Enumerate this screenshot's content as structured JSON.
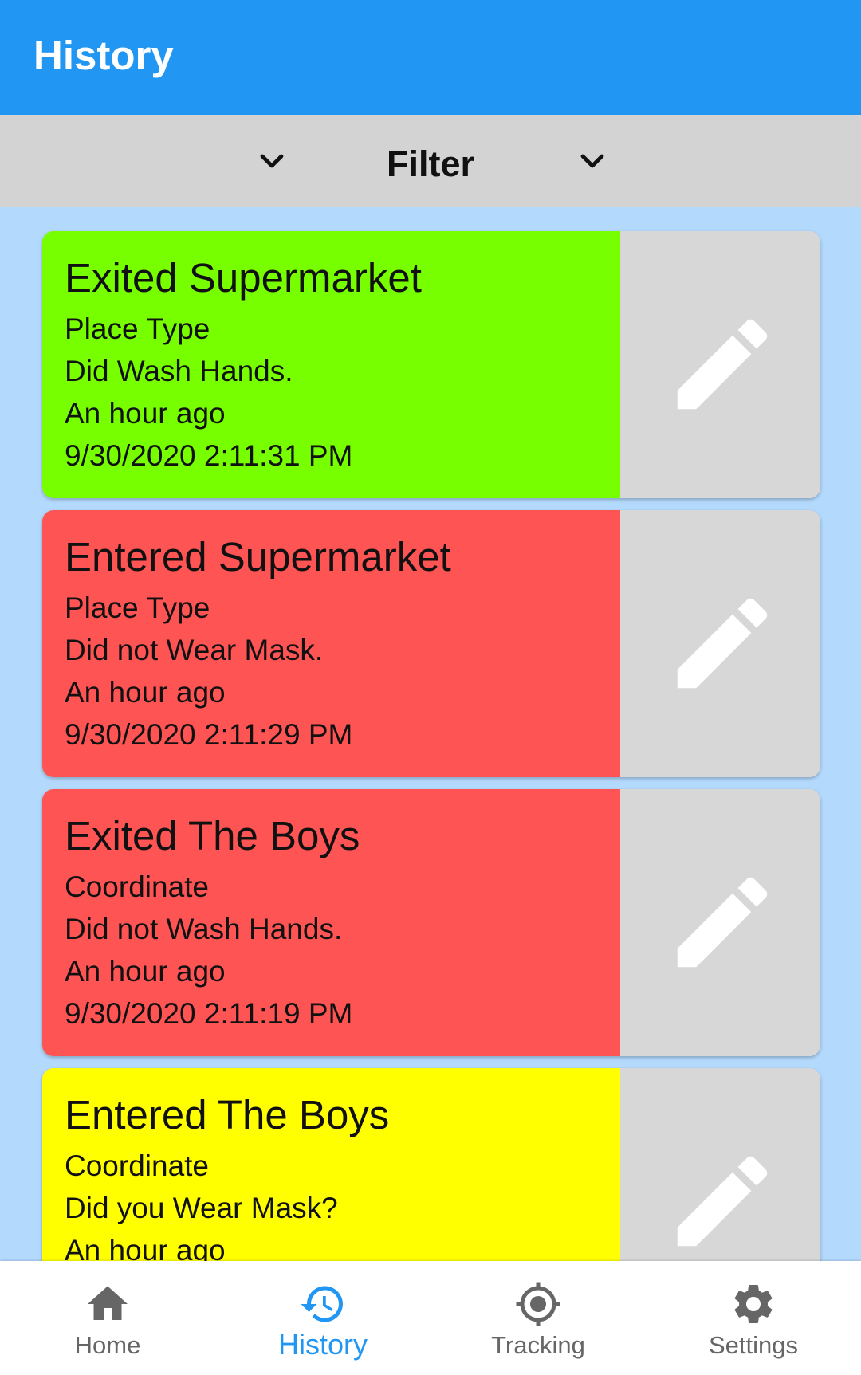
{
  "appbar": {
    "title": "History"
  },
  "filter": {
    "label": "Filter"
  },
  "colors": {
    "primary": "#2196f3",
    "green": "#77ff00",
    "red": "#ff5454",
    "yellow": "#ffff00",
    "list_bg": "#b3d9fd",
    "edit_bg": "#d7d7d7"
  },
  "entries": [
    {
      "title": "Exited Supermarket",
      "type": "Place Type",
      "status": "Did Wash Hands.",
      "relative": "An hour ago",
      "timestamp": "9/30/2020 2:11:31 PM",
      "color": "#77ff00"
    },
    {
      "title": "Entered Supermarket",
      "type": "Place Type",
      "status": "Did not Wear Mask.",
      "relative": "An hour ago",
      "timestamp": "9/30/2020 2:11:29 PM",
      "color": "#ff5454"
    },
    {
      "title": "Exited The Boys",
      "type": "Coordinate",
      "status": "Did not Wash Hands.",
      "relative": "An hour ago",
      "timestamp": "9/30/2020 2:11:19 PM",
      "color": "#ff5454"
    },
    {
      "title": "Entered The Boys",
      "type": "Coordinate",
      "status": "Did you Wear Mask?",
      "relative": "An hour ago",
      "timestamp": "",
      "color": "#ffff00"
    }
  ],
  "nav": {
    "items": [
      {
        "label": "Home",
        "icon": "home-icon"
      },
      {
        "label": "History",
        "icon": "history-icon",
        "active": true
      },
      {
        "label": "Tracking",
        "icon": "tracking-icon"
      },
      {
        "label": "Settings",
        "icon": "gear-icon"
      }
    ]
  }
}
